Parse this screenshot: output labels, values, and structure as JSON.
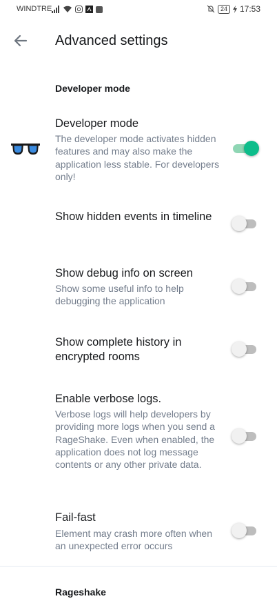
{
  "status_bar": {
    "carrier": "WINDTRE",
    "battery": "24",
    "time": "17:53"
  },
  "header": {
    "title": "Advanced settings",
    "back_icon": "arrow-left-icon"
  },
  "sections": [
    {
      "title": "Developer mode"
    },
    {
      "title": "Rageshake"
    }
  ],
  "settings": [
    {
      "title": "Developer mode",
      "subtitle": "The developer mode activates hidden features and may also make the application less stable. For developers only!",
      "enabled": true,
      "icon": "sunglasses-icon"
    },
    {
      "title": "Show hidden events in timeline",
      "subtitle": "",
      "enabled": false
    },
    {
      "title": "Show debug info on screen",
      "subtitle": "Show some useful info to help debugging the application",
      "enabled": false
    },
    {
      "title": "Show complete history in encrypted rooms",
      "subtitle": "",
      "enabled": false
    },
    {
      "title": "Enable verbose logs.",
      "subtitle": "Verbose logs will help developers by providing more logs when you send a RageShake. Even when enabled, the application does not log message contents or any other private data.",
      "enabled": false
    },
    {
      "title": "Fail-fast",
      "subtitle": "Element may crash more often when an unexpected error occurs",
      "enabled": false
    }
  ],
  "colors": {
    "accent": "#0dbd8b",
    "text_primary": "#17191c",
    "text_secondary": "#737d8c",
    "switch_off": "#bdbdbd"
  }
}
